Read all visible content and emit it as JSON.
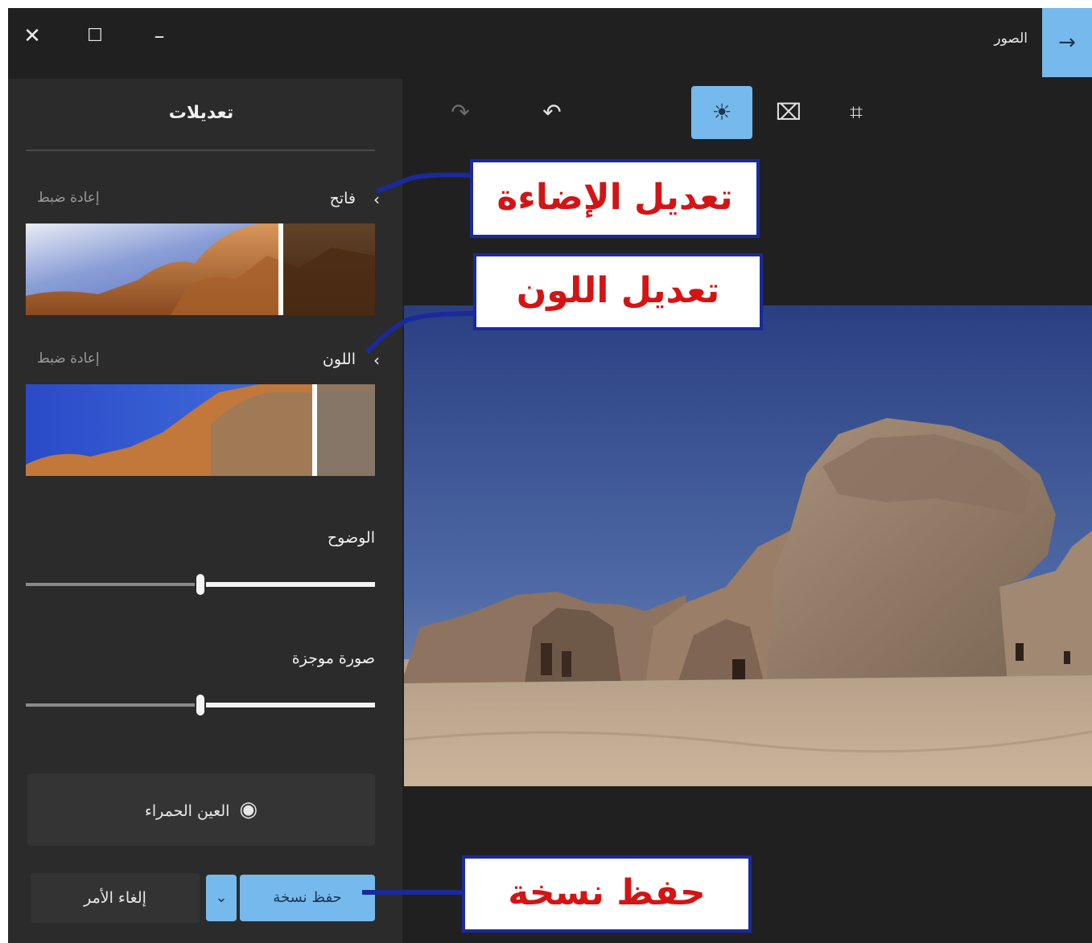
{
  "window": {
    "close_glyph": "✕",
    "maximize_glyph": "☐",
    "minimize_glyph": "–"
  },
  "header": {
    "app_title": "الصور",
    "back_glyph": "→"
  },
  "toolbar": {
    "redo_glyph": "↷",
    "undo_glyph": "↶",
    "adjust_glyph": "☀",
    "filter_glyph": "⌧",
    "crop_glyph": "⌗"
  },
  "panel": {
    "title": "تعديلات",
    "light": {
      "label": "فاتح",
      "reset": "إعادة ضبط"
    },
    "color": {
      "label": "اللون",
      "reset": "إعادة ضبط"
    },
    "clarity": {
      "label": "الوضوح",
      "value_fraction": 0.5
    },
    "vignette": {
      "label": "صورة موجزة",
      "value_fraction": 0.5
    },
    "red_eye": {
      "label": "العين الحمراء"
    },
    "save_copy": "حفظ نسخة",
    "cancel": "إلغاء الأمر",
    "dropdown_glyph": "⌄"
  },
  "callouts": {
    "lighting": "تعديل الإضاءة",
    "color": "تعديل اللون",
    "save": "حفظ نسخة"
  },
  "colors": {
    "accent": "#76b9ed",
    "callout_text": "#d41414",
    "callout_border": "#1a2a9a"
  }
}
